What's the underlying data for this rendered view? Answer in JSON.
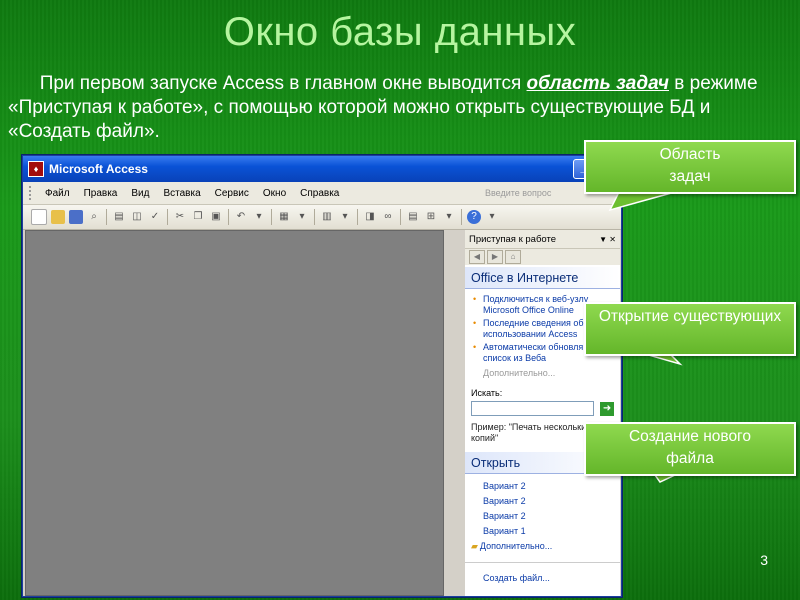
{
  "slide": {
    "title": "Окно базы данных",
    "intro_part1": "При первом запуске Access в главном окне выводится ",
    "intro_emph": "область задач",
    "intro_part2": " в режиме «Приступая к работе», с помощью которой можно открыть существующие БД и «Создать файл».",
    "page_number": "3"
  },
  "window": {
    "title": "Microsoft Access",
    "menu": [
      "Файл",
      "Правка",
      "Вид",
      "Вставка",
      "Сервис",
      "Окно",
      "Справка"
    ],
    "ask_placeholder": "Введите вопрос"
  },
  "task_pane": {
    "header": "Приступая к работе",
    "section_online": "Office в Интернете",
    "links": [
      "Подключиться к веб-узлу Microsoft Office Online",
      "Последние сведения об использовании Access",
      "Автоматически обновля этот список из Веба"
    ],
    "more": "Дополнительно...",
    "search_label": "Искать:",
    "example": "Пример: \"Печать нескольки копий\"",
    "section_open": "Открыть",
    "open_items": [
      "Вариант 2",
      "Вариант 2",
      "Вариант 2",
      "Вариант 1"
    ],
    "open_more": "Дополнительно...",
    "create": "Создать файл..."
  },
  "callouts": {
    "task_area": "Область задач",
    "open_existing": "Открытие существующих",
    "create_new": "Создание нового файла"
  },
  "colors": {
    "title_green": "#b6f5a0",
    "callout_green": "#7ccc3c",
    "xp_blue": "#0a52d6"
  }
}
